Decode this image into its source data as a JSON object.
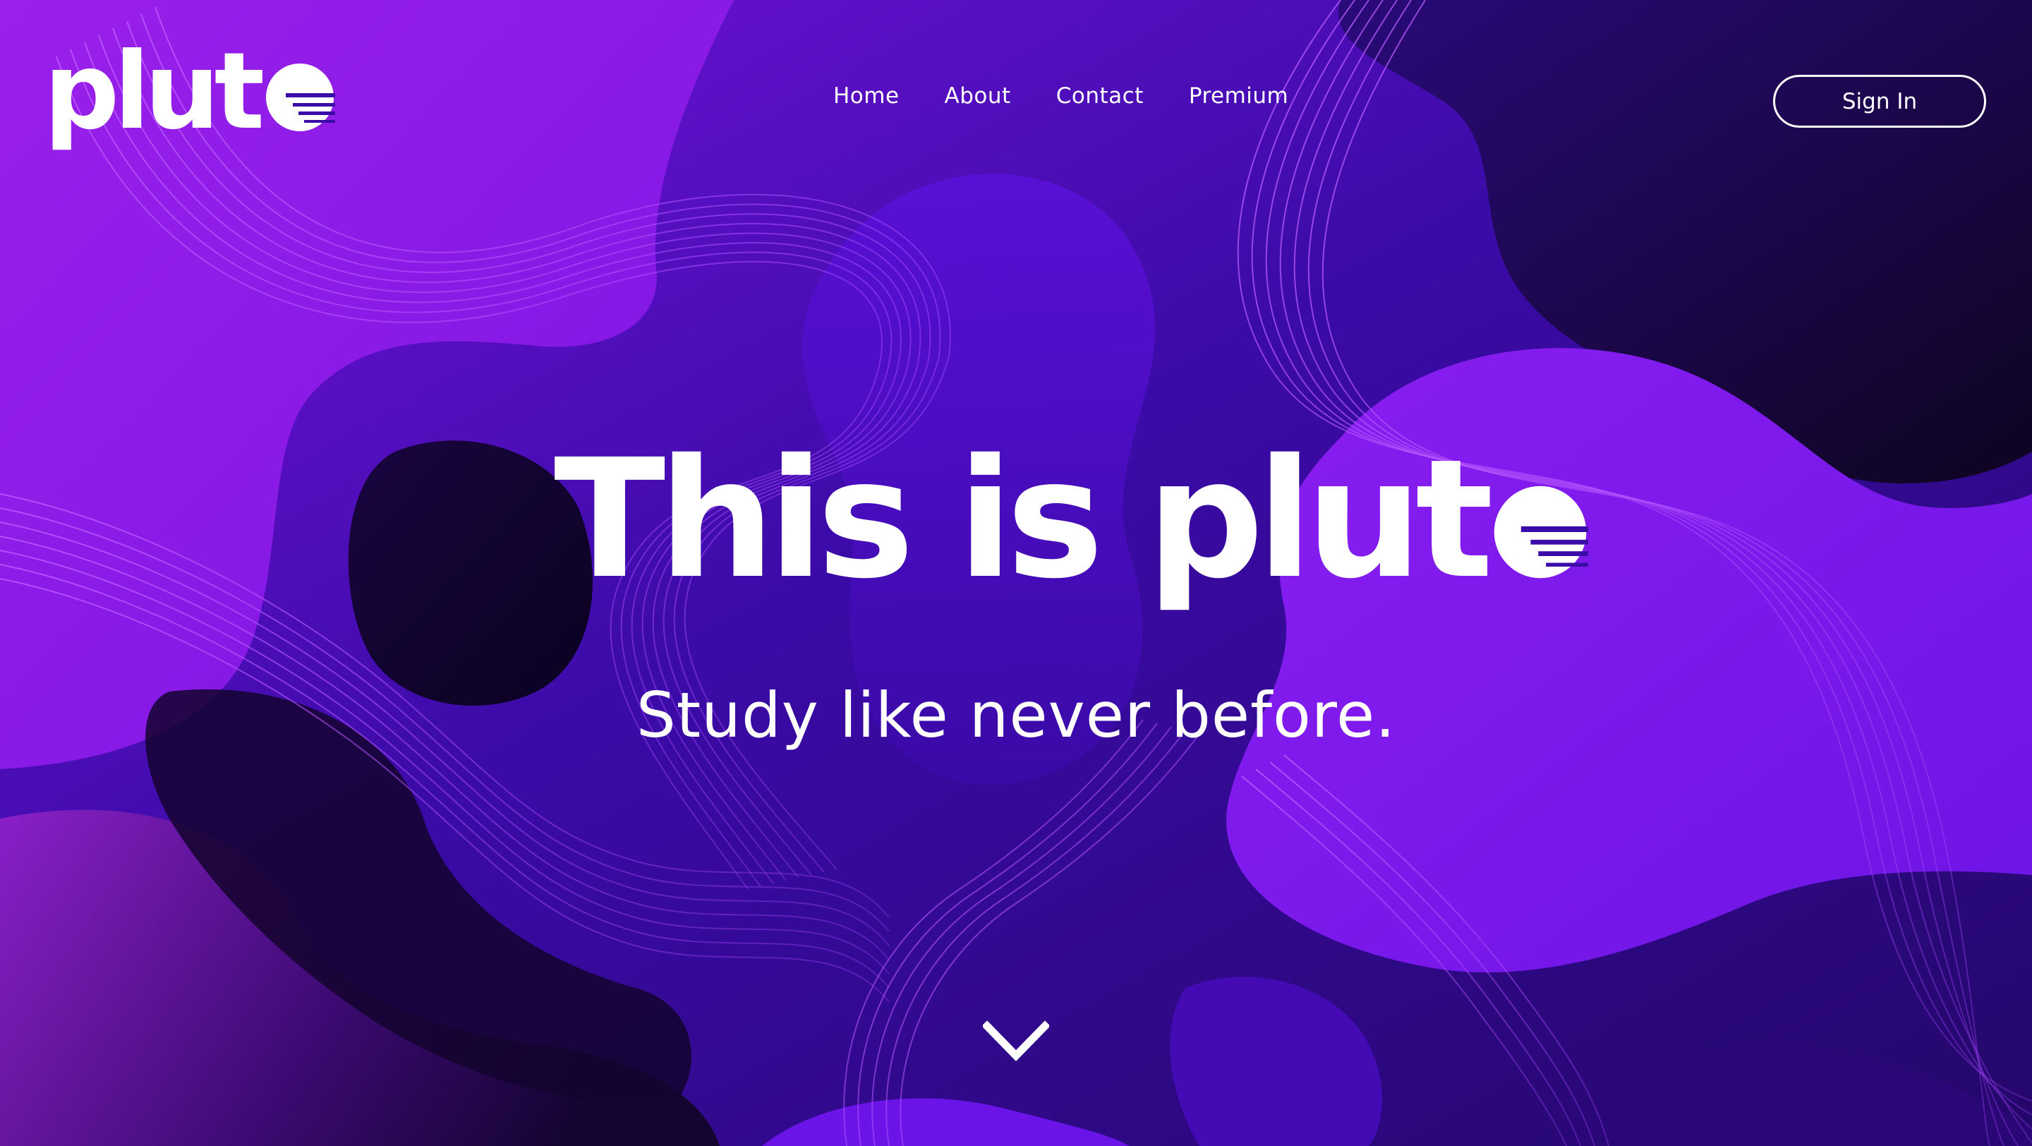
{
  "brand": {
    "logo_text": "plut",
    "logo_icon": "planet-o-icon"
  },
  "nav": {
    "items": [
      {
        "label": "Home"
      },
      {
        "label": "About"
      },
      {
        "label": "Contact"
      },
      {
        "label": "Premium"
      }
    ],
    "sign_in_label": "Sign In"
  },
  "hero": {
    "title": "This is plut",
    "title_icon": "planet-o-icon",
    "subtitle": "Study like never before."
  },
  "scroll": {
    "icon": "chevron-down-icon"
  },
  "colors": {
    "background_dark": "#1a0640",
    "background_mid": "#3a0ca8",
    "accent_violet": "#8a1ae8",
    "accent_purple": "#6a12e6",
    "text": "#ffffff"
  }
}
